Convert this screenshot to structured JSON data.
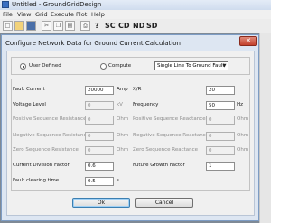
{
  "window": {
    "title": "Untitled - GroundGridDesign"
  },
  "menu": [
    "File",
    "View",
    "Grid",
    "Execute",
    "Plot",
    "Help"
  ],
  "toolbar": {
    "buttons": [
      "new-file-icon",
      "open-folder-icon",
      "save-icon",
      "cut-icon",
      "copy-icon",
      "paste-icon",
      "print-icon"
    ],
    "text_buttons": [
      "?",
      "SC",
      "CD",
      "ND",
      "SD"
    ]
  },
  "dialog": {
    "title": "Configure Network Data for Ground Current  Calculation",
    "mode": {
      "user_defined": "User Defined",
      "compute": "Compute",
      "selected": "user_defined"
    },
    "fault_type": "Single Line To Ground Fault",
    "fields": {
      "fault_current": {
        "label": "Fault Current",
        "value": "20000",
        "unit": "Amp"
      },
      "voltage_level": {
        "label": "Voltage Level",
        "value": "0",
        "unit": "kV"
      },
      "positive_resistance": {
        "label": "Positive Sequence Resistance",
        "value": "0",
        "unit": "Ohm"
      },
      "negative_resistance": {
        "label": "Negative Sequence Resistance",
        "value": "0",
        "unit": "Ohm"
      },
      "zero_resistance": {
        "label": "Zero Sequence Resistance",
        "value": "0",
        "unit": "Ohm"
      },
      "current_division": {
        "label": "Current Division Factor",
        "value": "0.6"
      },
      "fault_clearing_time": {
        "label": "Fault clearing time",
        "value": "0.5",
        "unit": "s"
      },
      "xr": {
        "label": "X/R",
        "value": "20"
      },
      "frequency": {
        "label": "Frequency",
        "value": "50",
        "unit": "Hz"
      },
      "positive_reactance": {
        "label": "Positive Sequence Reactance",
        "value": "0",
        "unit": "Ohm"
      },
      "negative_reactance": {
        "label": "Negative Sequence Reactance",
        "value": "0",
        "unit": "Ohm"
      },
      "zero_reactance": {
        "label": "Zero Sequence Reactance",
        "value": "0",
        "unit": "Ohm"
      },
      "future_growth": {
        "label": "Future Growth Factor",
        "value": "1"
      }
    },
    "buttons": {
      "ok": "Ok",
      "cancel": "Cancel"
    }
  }
}
